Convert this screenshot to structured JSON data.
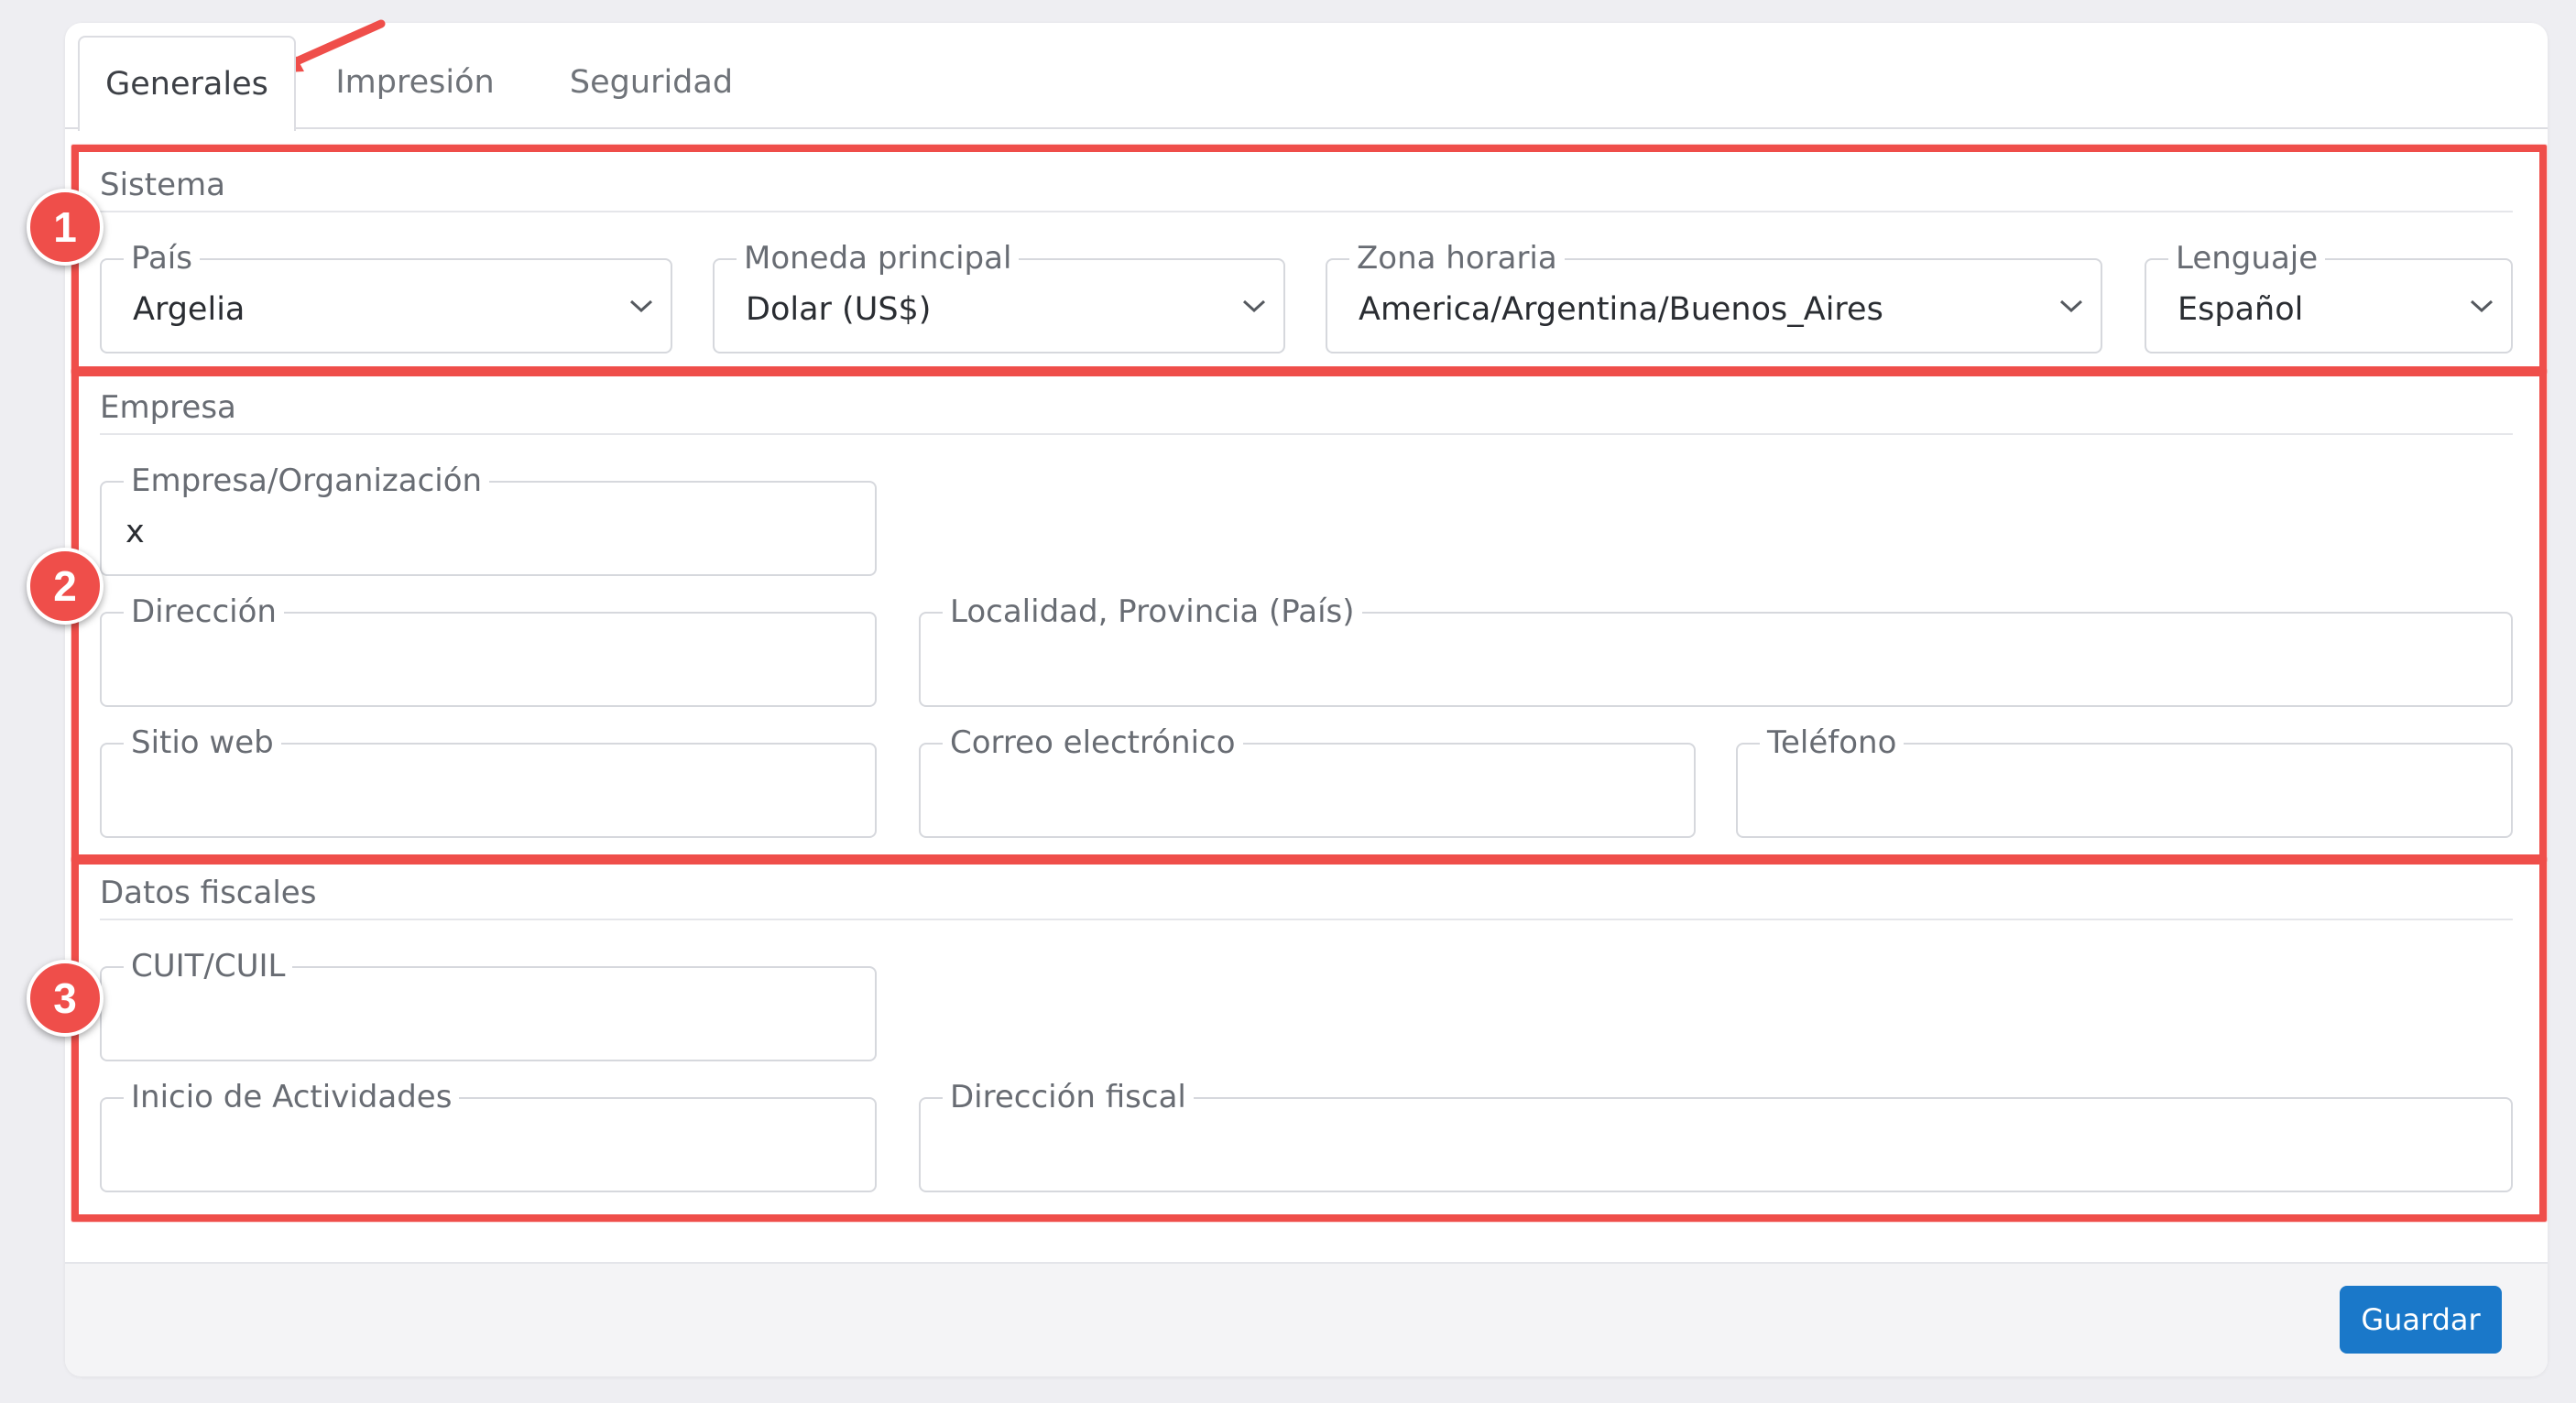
{
  "tabs": [
    {
      "label": "Generales",
      "active": true
    },
    {
      "label": "Impresión",
      "active": false
    },
    {
      "label": "Seguridad",
      "active": false
    }
  ],
  "sections": {
    "sistema": {
      "title": "Sistema",
      "fields": {
        "pais": {
          "label": "País",
          "value": "Argelia"
        },
        "moneda": {
          "label": "Moneda principal",
          "value": "Dolar (US$)"
        },
        "zona": {
          "label": "Zona horaria",
          "value": "America/Argentina/Buenos_Aires"
        },
        "lenguaje": {
          "label": "Lenguaje",
          "value": "Español"
        }
      }
    },
    "empresa": {
      "title": "Empresa",
      "fields": {
        "organizacion": {
          "label": "Empresa/Organización",
          "value": "x"
        },
        "direccion": {
          "label": "Dirección",
          "value": ""
        },
        "localidad": {
          "label": "Localidad, Provincia (País)",
          "value": ""
        },
        "sitio_web": {
          "label": "Sitio web",
          "value": ""
        },
        "correo": {
          "label": "Correo electrónico",
          "value": ""
        },
        "telefono": {
          "label": "Teléfono",
          "value": ""
        }
      }
    },
    "fiscales": {
      "title": "Datos fiscales",
      "fields": {
        "cuit": {
          "label": "CUIT/CUIL",
          "value": ""
        },
        "inicio": {
          "label": "Inicio de Actividades",
          "value": ""
        },
        "direccion_fiscal": {
          "label": "Dirección fiscal",
          "value": ""
        }
      }
    }
  },
  "footer": {
    "save_label": "Guardar"
  },
  "annotations": {
    "badge_1": "1",
    "badge_2": "2",
    "badge_3": "3"
  },
  "colors": {
    "accent": "#1a78c9",
    "annotation": "#ef4e4a",
    "background": "#eeeef2"
  },
  "icons": {
    "select": "chevron-down-icon",
    "pointer": "arrow-annotation-icon"
  }
}
